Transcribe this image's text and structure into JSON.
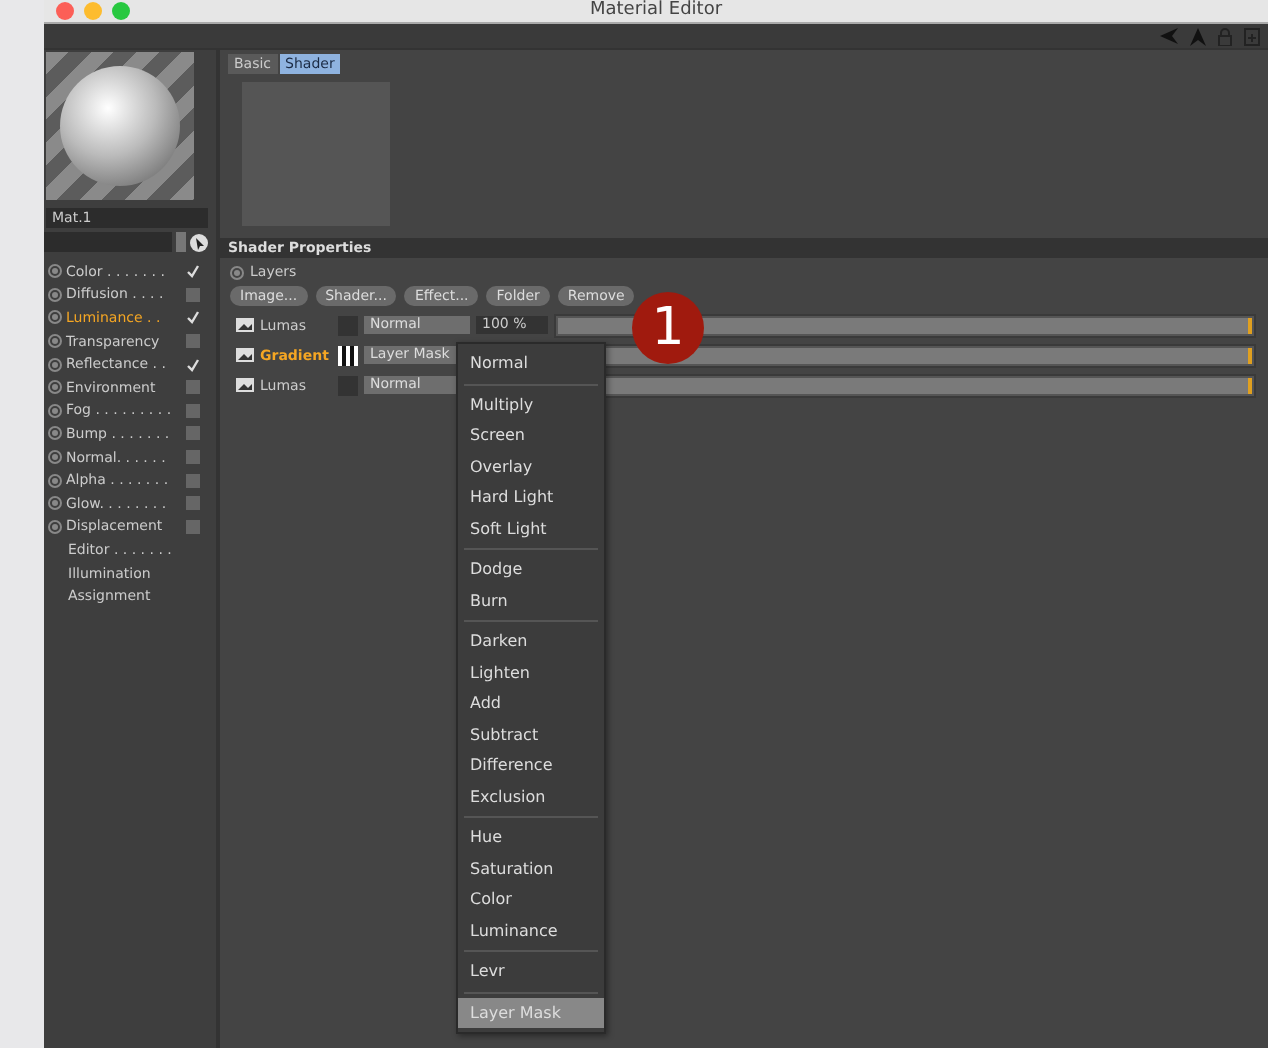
{
  "window": {
    "title": "Material Editor"
  },
  "material": {
    "name": "Mat.1"
  },
  "channels": [
    {
      "kind": "option",
      "label": "Color . . . . . . .",
      "checked": true,
      "selected": false
    },
    {
      "kind": "option",
      "label": "Diffusion . . . .",
      "checked": false,
      "selected": false
    },
    {
      "kind": "option",
      "label": "Luminance . .",
      "checked": true,
      "selected": true
    },
    {
      "kind": "option",
      "label": "Transparency",
      "checked": false,
      "selected": false
    },
    {
      "kind": "option",
      "label": "Reflectance . .",
      "checked": true,
      "selected": false
    },
    {
      "kind": "option",
      "label": "Environment",
      "checked": false,
      "selected": false
    },
    {
      "kind": "option",
      "label": "Fog . . . . . . . . .",
      "checked": false,
      "selected": false
    },
    {
      "kind": "option",
      "label": "Bump . . . . . . .",
      "checked": false,
      "selected": false
    },
    {
      "kind": "option",
      "label": "Normal. . . . . .",
      "checked": false,
      "selected": false
    },
    {
      "kind": "option",
      "label": "Alpha . . . . . . .",
      "checked": false,
      "selected": false
    },
    {
      "kind": "option",
      "label": "Glow. . . . . . . .",
      "checked": false,
      "selected": false
    },
    {
      "kind": "option",
      "label": "Displacement",
      "checked": false,
      "selected": false
    },
    {
      "kind": "plain",
      "label": "Editor . . . . . . ."
    },
    {
      "kind": "plain",
      "label": "Illumination"
    },
    {
      "kind": "plain",
      "label": "Assignment"
    }
  ],
  "tabs": [
    {
      "label": "Basic",
      "selected": false
    },
    {
      "label": "Shader",
      "selected": true
    }
  ],
  "section_title": "Shader Properties",
  "layers_label": "Layers",
  "buttons": [
    "Image...",
    "Shader...",
    "Effect...",
    "Folder",
    "Remove"
  ],
  "layers": [
    {
      "name": "Lumas",
      "selected": false,
      "kind": "plain",
      "mode": "Normal",
      "percent": "100 %",
      "level": 1
    },
    {
      "name": "Gradient",
      "selected": true,
      "kind": "gradient",
      "mode": "Layer Mask",
      "level": 1
    },
    {
      "name": "Lumas",
      "selected": false,
      "kind": "plain",
      "mode": "Normal",
      "level": 1
    }
  ],
  "step_badge": "1",
  "menu": [
    [
      {
        "label": "Normal",
        "selected": false
      }
    ],
    [
      {
        "label": "Multiply",
        "selected": false
      },
      {
        "label": "Screen",
        "selected": false
      },
      {
        "label": "Overlay",
        "selected": false
      },
      {
        "label": "Hard Light",
        "selected": false
      },
      {
        "label": "Soft Light",
        "selected": false
      }
    ],
    [
      {
        "label": "Dodge",
        "selected": false
      },
      {
        "label": "Burn",
        "selected": false
      }
    ],
    [
      {
        "label": "Darken",
        "selected": false
      },
      {
        "label": "Lighten",
        "selected": false
      },
      {
        "label": "Add",
        "selected": false
      },
      {
        "label": "Subtract",
        "selected": false
      },
      {
        "label": "Difference",
        "selected": false
      },
      {
        "label": "Exclusion",
        "selected": false
      }
    ],
    [
      {
        "label": "Hue",
        "selected": false
      },
      {
        "label": "Saturation",
        "selected": false
      },
      {
        "label": "Color",
        "selected": false
      },
      {
        "label": "Luminance",
        "selected": false
      }
    ],
    [
      {
        "label": "Levr",
        "selected": false
      }
    ],
    [
      {
        "label": "Layer Mask",
        "selected": true
      }
    ]
  ]
}
